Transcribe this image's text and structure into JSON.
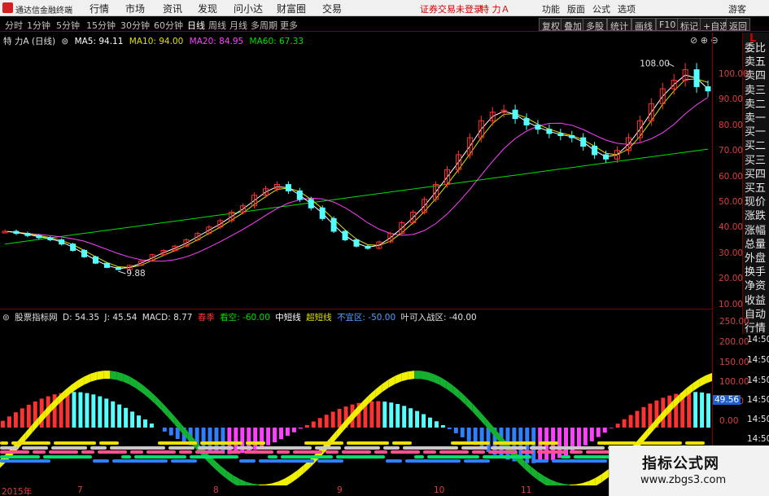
{
  "app": {
    "name": "通达信金融终端"
  },
  "menu": [
    "行情",
    "市场",
    "资讯",
    "发现",
    "问小达",
    "财富圈",
    "交易"
  ],
  "warning": "证券交易未登录",
  "stock": "特 力Ａ",
  "right_menu": [
    "功能",
    "版面",
    "公式",
    "选项"
  ],
  "guest": "游客",
  "periods": [
    "分时",
    "1分钟",
    "5分钟",
    "15分钟",
    "30分钟",
    "60分钟",
    "日线",
    "周线",
    "月线",
    "多周期",
    "更多"
  ],
  "active_period": "日线",
  "toolbar_buttons": [
    "复权",
    "叠加",
    "多股",
    "统计",
    "画线",
    "F10",
    "标记",
    "+自选",
    "返回"
  ],
  "price_legend": {
    "title": "特 力A (日线)",
    "ma5": "MA5: 94.11",
    "ma10": "MA10: 94.00",
    "ma20": "MA20: 84.95",
    "ma60": "MA60: 67.33"
  },
  "price_axis": [
    "100.00",
    "90.00",
    "80.00",
    "70.00",
    "60.00",
    "50.00",
    "40.00",
    "30.00",
    "20.00",
    "10.00"
  ],
  "annotations": {
    "high": "108.00",
    "low": "9.88"
  },
  "sidebar_items": [
    "委比",
    "卖五",
    "卖四",
    "卖三",
    "卖二",
    "卖一",
    "买一",
    "买二",
    "买三",
    "买四",
    "买五",
    "现价",
    "涨跌",
    "涨幅",
    "总量",
    "外盘",
    "换手",
    "净资",
    "收益",
    "自动",
    "行情"
  ],
  "sidebar_top": "L",
  "indicator_legend": {
    "name": "股票指标网",
    "d": "D: 54.35",
    "j": "J: 45.54",
    "macd": "MACD: 8.77",
    "s1": "春季",
    "s2": "看空: -60.00",
    "s3": "中短线",
    "s4": "超短线",
    "s5": "不宜区: -50.00",
    "s6": "叶可入战区: -40.00"
  },
  "indicator_axis": [
    "250.00",
    "200.00",
    "150.00",
    "100.00",
    "50.00",
    "0.00"
  ],
  "indicator_value": "49.56",
  "indicator_axis_right": [
    "14:50",
    "14:50",
    "14:50",
    "14:50",
    "14:50",
    "14:50"
  ],
  "date_axis": [
    "2015年",
    "7",
    "8",
    "9",
    "10",
    "11"
  ],
  "watermark": {
    "title": "指标公式网",
    "url": "www.zbgs3.com"
  },
  "colors": {
    "up": "#ff3232",
    "down": "#54ffff",
    "ma5": "#ffffff",
    "ma10": "#e0e000",
    "ma20": "#ff40ff",
    "ma60": "#00e000",
    "axis": "#d84040",
    "frame": "#7a0000"
  },
  "chart_data": {
    "type": "candlestick",
    "ma5_value": 94.11,
    "ma10_value": 94.0,
    "ma20_value": 84.95,
    "ma60_value": 67.33,
    "high": 108.0,
    "low": 9.88,
    "close_series_approx": [
      28,
      27,
      26,
      25,
      24,
      22,
      19,
      16,
      13,
      11,
      10,
      12,
      14,
      17,
      19,
      21,
      24,
      27,
      30,
      33,
      37,
      40,
      45,
      48,
      50,
      47,
      43,
      39,
      34,
      28,
      24,
      21,
      20,
      23,
      27,
      32,
      37,
      43,
      50,
      57,
      64,
      72,
      80,
      84,
      85,
      81,
      78,
      76,
      74,
      73,
      72,
      68,
      64,
      62,
      66,
      72,
      80,
      88,
      95,
      99,
      104,
      96,
      94
    ]
  }
}
